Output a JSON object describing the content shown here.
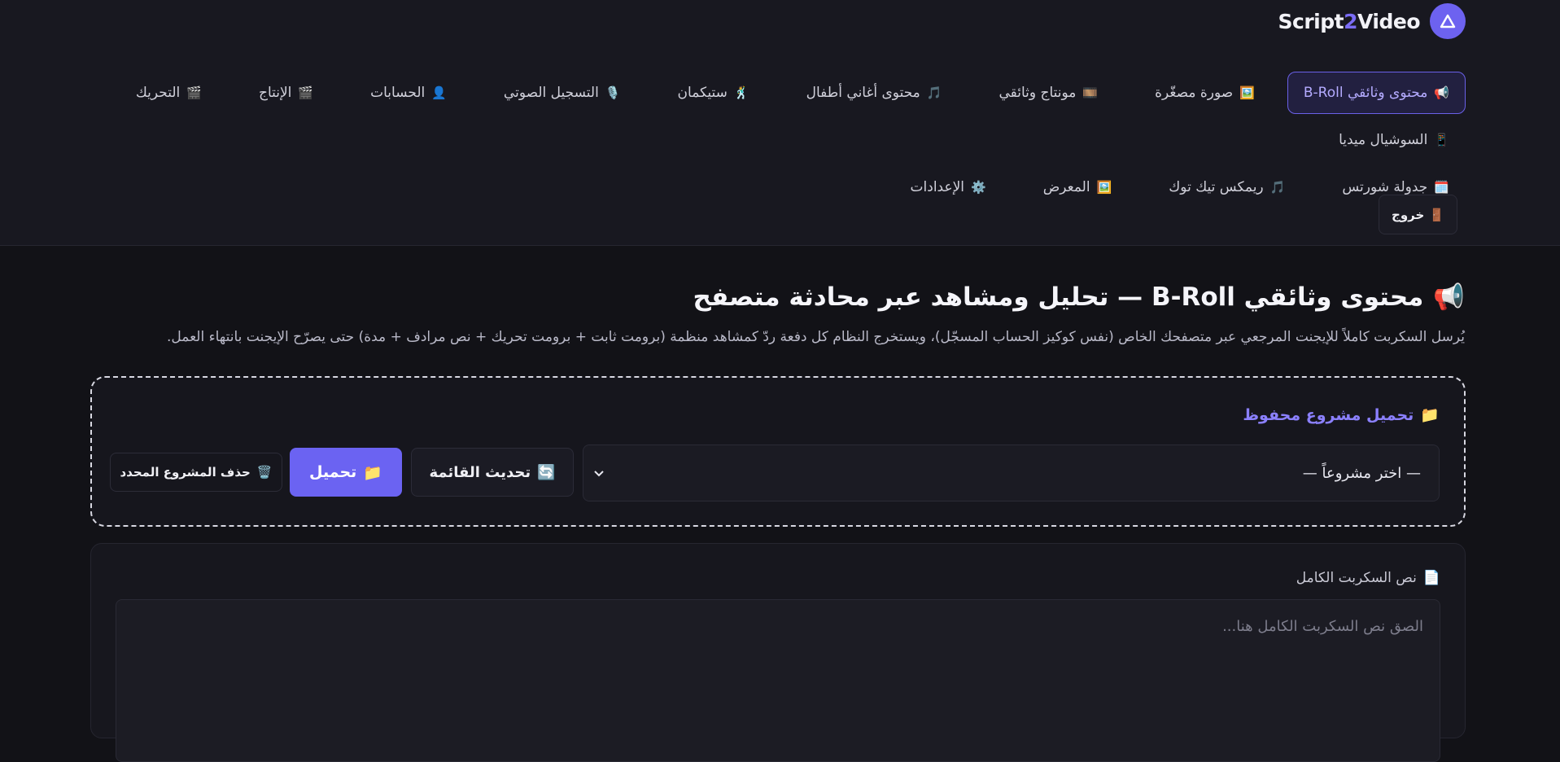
{
  "brand": {
    "name_part1": "Script",
    "name_accent": "2",
    "name_part2": "Video"
  },
  "nav": [
    {
      "icon": "📢",
      "label": "محتوى وثائقي B-Roll",
      "active": true
    },
    {
      "icon": "🖼️",
      "label": "صورة مصغّرة"
    },
    {
      "icon": "🎞️",
      "label": "مونتاج وثائقي"
    },
    {
      "icon": "🎵",
      "label": "محتوى أغاني أطفال"
    },
    {
      "icon": "🕺",
      "label": "ستيكمان"
    },
    {
      "icon": "🎙️",
      "label": "التسجيل الصوتي"
    },
    {
      "icon": "👤",
      "label": "الحسابات"
    },
    {
      "icon": "🎬",
      "label": "الإنتاج"
    },
    {
      "icon": "🎬",
      "label": "التحريك"
    },
    {
      "icon": "📱",
      "label": "السوشيال ميديا"
    },
    {
      "icon": "🗓️",
      "label": "جدولة شورتس"
    },
    {
      "icon": "🎵",
      "label": "ريمكس تيك توك"
    },
    {
      "icon": "🖼️",
      "label": "المعرض"
    },
    {
      "icon": "⚙️",
      "label": "الإعدادات"
    }
  ],
  "logout": {
    "icon": "🚪",
    "label": "خروج"
  },
  "page": {
    "icon": "📢",
    "title": "محتوى وثائقي B-Roll — تحليل ومشاهد عبر محادثة متصفح",
    "description": "يُرسل السكربت كاملاً للإيجنت المرجعي عبر متصفحك الخاص (نفس كوكيز الحساب المسجّل)، ويستخرج النظام كل دفعة ردّ كمشاهد منظمة (برومت ثابت + برومت تحريك + نص مرادف + مدة) حتى يصرّح الإيجنت بانتهاء العمل."
  },
  "load_project": {
    "icon": "📁",
    "title": "تحميل مشروع محفوظ",
    "select_value": "— اختر مشروعاً —",
    "refresh_icon": "🔄",
    "refresh_label": "تحديث القائمة",
    "load_icon": "📁",
    "load_label": "تحميل",
    "delete_icon": "🗑️",
    "delete_label": "حذف المشروع المحدد"
  },
  "script": {
    "icon": "📄",
    "label": "نص السكربت الكامل",
    "placeholder": "الصق نص السكربت الكامل هنا..."
  },
  "colors": {
    "accent": "#6b63f2",
    "background": "#121217",
    "topbar": "#181820"
  }
}
